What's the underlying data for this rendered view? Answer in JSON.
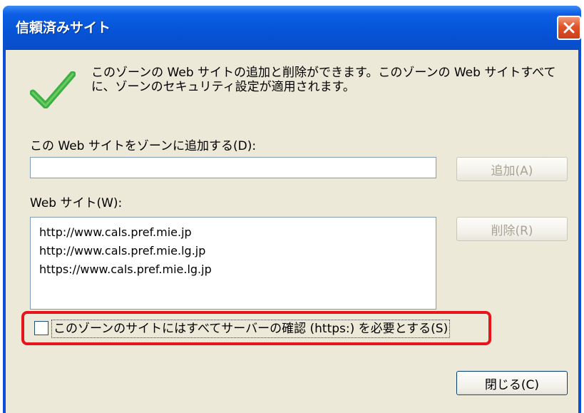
{
  "window": {
    "title": "信頼済みサイト",
    "close_icon": "close-icon"
  },
  "info": {
    "icon": "checkmark-icon",
    "description": "このゾーンの Web サイトの追加と削除ができます。このゾーンの Web サイトすべてに、ゾーンのセキュリティ設定が適用されます。"
  },
  "add_section": {
    "label": "この Web サイトをゾーンに追加する(D):",
    "input_value": "",
    "add_button": "追加(A)"
  },
  "sites_section": {
    "label": "Web サイト(W):",
    "sites": [
      "http://www.cals.pref.mie.jp",
      "http://www.cals.pref.mie.lg.jp",
      "https://www.cals.pref.mie.lg.jp"
    ],
    "remove_button": "削除(R)"
  },
  "https_option": {
    "label": "このゾーンのサイトにはすべてサーバーの確認 (https:) を必要とする(S)",
    "checked": false
  },
  "footer": {
    "close_button": "閉じる(C)"
  },
  "colors": {
    "titlebar": "#0553d6",
    "dialog_bg": "#ece9d8",
    "highlight": "#e8141c",
    "checkmark": "#3cb043"
  }
}
